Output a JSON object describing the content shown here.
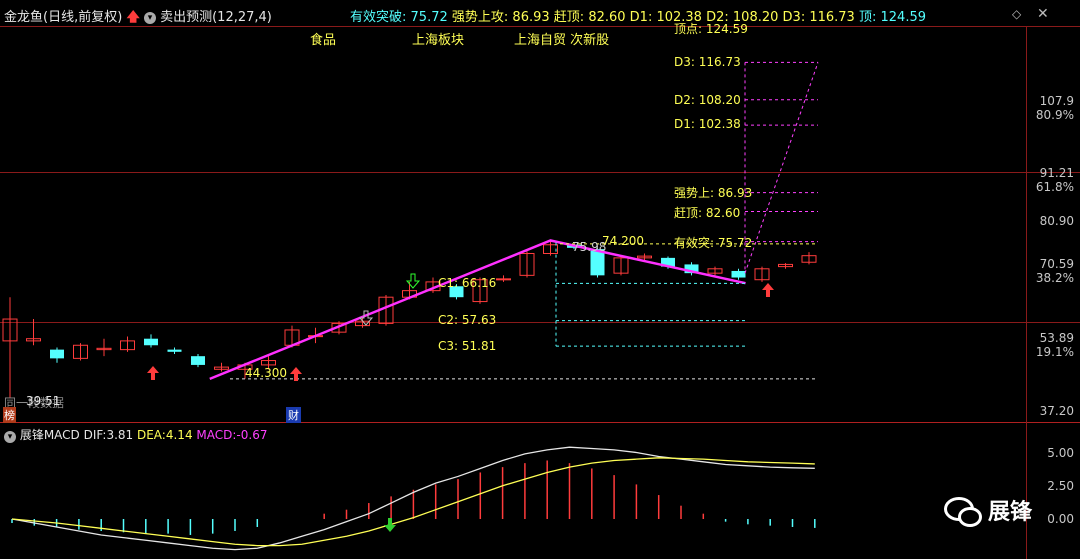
{
  "header": {
    "stock_name": "金龙鱼",
    "period": "(日线,前复权)",
    "indicator_name": "卖出预测",
    "indicator_params": "(12,27,4)",
    "targets": [
      {
        "label": "有效突破",
        "value": "75.72"
      },
      {
        "label": "强势上攻",
        "value": "86.93"
      },
      {
        "label": "赶顶",
        "value": "82.60"
      },
      {
        "label": "D1",
        "value": "102.38"
      },
      {
        "label": "D2",
        "value": "108.20"
      },
      {
        "label": "D3",
        "value": "116.73"
      },
      {
        "label": "顶",
        "value": "124.59"
      }
    ],
    "tags": [
      "食品",
      "上海板块",
      "上海自贸 次新股"
    ]
  },
  "right_levels": [
    {
      "label": "顶点: 124.59",
      "value": 124.59
    },
    {
      "label": "D3: 116.73",
      "value": 116.73
    },
    {
      "label": "D2: 108.20",
      "value": 108.2
    },
    {
      "label": "D1: 102.38",
      "value": 102.38
    },
    {
      "label": "强势上: 86.93",
      "value": 86.93
    },
    {
      "label": "赶顶: 82.60",
      "value": 82.6
    },
    {
      "label": "有效突: 75.72",
      "value": 75.72
    }
  ],
  "c_levels": [
    {
      "label": "C1: 66.16",
      "value": 66.16
    },
    {
      "label": "C2: 57.63",
      "value": 57.63
    },
    {
      "label": "C3: 51.81",
      "value": 51.81
    }
  ],
  "annotations": {
    "low_price": "44.300",
    "high_price": "75.98",
    "later_high": "74.200",
    "bottom_left_text": "同一段数据",
    "bottom_left_value": "39.51",
    "bottom_left_badge": "榜",
    "fin_badge": "财"
  },
  "price_axis": [
    {
      "v": "107.9",
      "p": "80.9%"
    },
    {
      "v": "91.21",
      "p": "61.8%"
    },
    {
      "v": "80.90",
      "p": ""
    },
    {
      "v": "70.59",
      "p": "38.2%"
    },
    {
      "v": "53.89",
      "p": "19.1%"
    },
    {
      "v": "37.20",
      "p": ""
    }
  ],
  "macd": {
    "name": "展锋MACD",
    "dif_label": "DIF:",
    "dif": "3.81",
    "dea_label": "DEA:",
    "dea": "4.14",
    "macd_label": "MACD:",
    "macd": "-0.67",
    "axis": [
      "5.00",
      "2.50",
      "0.00"
    ]
  },
  "watermark": {
    "text": "展锋"
  },
  "colors": {
    "up": "#ff3c3c",
    "down": "#54ffff",
    "trend": "#ff30ff",
    "yellow": "#ffff55",
    "cyan": "#54ffff",
    "magenta": "#ff40ff",
    "white": "#e6e6e6",
    "grid": "#8a1a1a"
  },
  "chart_data": {
    "type": "candlestick",
    "ylim": [
      37.2,
      124.59
    ],
    "candles": [
      {
        "o": 53,
        "c": 58,
        "h": 63,
        "l": 40
      },
      {
        "o": 53,
        "c": 53.5,
        "h": 58,
        "l": 52
      },
      {
        "o": 51,
        "c": 49,
        "h": 51.5,
        "l": 48
      },
      {
        "o": 49,
        "c": 52,
        "h": 52.5,
        "l": 48.5
      },
      {
        "o": 51,
        "c": 51.3,
        "h": 53.5,
        "l": 49.5
      },
      {
        "o": 51,
        "c": 53,
        "h": 54,
        "l": 50.5
      },
      {
        "o": 53.5,
        "c": 52,
        "h": 54.5,
        "l": 51.5
      },
      {
        "o": 51,
        "c": 50.5,
        "h": 51.5,
        "l": 50
      },
      {
        "o": 49.5,
        "c": 47.5,
        "h": 50,
        "l": 47
      },
      {
        "o": 46.5,
        "c": 47,
        "h": 48,
        "l": 46
      },
      {
        "o": 46.5,
        "c": 47.5,
        "h": 48,
        "l": 44.3
      },
      {
        "o": 47.5,
        "c": 48.5,
        "h": 49.5,
        "l": 46.5
      },
      {
        "o": 52,
        "c": 55.5,
        "h": 56.5,
        "l": 51.5
      },
      {
        "o": 54,
        "c": 54.2,
        "h": 56,
        "l": 52.5
      },
      {
        "o": 55,
        "c": 57,
        "h": 57.5,
        "l": 54.5
      },
      {
        "o": 56.5,
        "c": 57.5,
        "h": 58.5,
        "l": 56
      },
      {
        "o": 57,
        "c": 63,
        "h": 63.5,
        "l": 56.5
      },
      {
        "o": 63,
        "c": 64.5,
        "h": 66.5,
        "l": 62.5
      },
      {
        "o": 64.5,
        "c": 66.5,
        "h": 67.5,
        "l": 64
      },
      {
        "o": 65.5,
        "c": 63,
        "h": 66,
        "l": 62.5
      },
      {
        "o": 62,
        "c": 67,
        "h": 67.5,
        "l": 61.5
      },
      {
        "o": 67,
        "c": 67.2,
        "h": 68,
        "l": 66.5
      },
      {
        "o": 68,
        "c": 73,
        "h": 73.5,
        "l": 67.5
      },
      {
        "o": 73,
        "c": 75,
        "h": 75.98,
        "l": 72.5
      },
      {
        "o": 75,
        "c": 74.3,
        "h": 75.2,
        "l": 74
      },
      {
        "o": 74,
        "c": 68,
        "h": 74.2,
        "l": 67.5
      },
      {
        "o": 68.5,
        "c": 72,
        "h": 72.5,
        "l": 68
      },
      {
        "o": 72,
        "c": 72.4,
        "h": 73,
        "l": 71.5
      },
      {
        "o": 72,
        "c": 70,
        "h": 72.3,
        "l": 69.5
      },
      {
        "o": 70.5,
        "c": 68.5,
        "h": 71,
        "l": 68
      },
      {
        "o": 68.5,
        "c": 69.5,
        "h": 70,
        "l": 68
      },
      {
        "o": 69,
        "c": 67.5,
        "h": 69.5,
        "l": 67
      },
      {
        "o": 67,
        "c": 69.5,
        "h": 70,
        "l": 66.5
      },
      {
        "o": 70,
        "c": 70.5,
        "h": 70.8,
        "l": 69.5
      },
      {
        "o": 71,
        "c": 72.5,
        "h": 73.3,
        "l": 70.5
      }
    ],
    "macd_hist": [
      -0.3,
      -0.5,
      -0.6,
      -0.8,
      -0.9,
      -1.0,
      -1.1,
      -1.1,
      -1.2,
      -1.1,
      -0.9,
      -0.6,
      0,
      0,
      0.4,
      0.7,
      1.2,
      1.7,
      2.2,
      2.6,
      3.0,
      3.5,
      3.9,
      4.2,
      4.4,
      4.2,
      3.8,
      3.3,
      2.6,
      1.8,
      1.0,
      0.4,
      -0.2,
      -0.4,
      -0.5,
      -0.6,
      -0.67
    ],
    "dif": [
      0,
      -0.3,
      -0.6,
      -0.9,
      -1.2,
      -1.4,
      -1.6,
      -1.8,
      -2.0,
      -2.2,
      -2.3,
      -2.2,
      -1.8,
      -1.3,
      -0.8,
      -0.2,
      0.4,
      1.2,
      2.0,
      2.7,
      3.2,
      3.8,
      4.4,
      4.9,
      5.2,
      5.4,
      5.3,
      5.2,
      5.0,
      4.7,
      4.5,
      4.3,
      4.1,
      4.0,
      3.9,
      3.85,
      3.81
    ],
    "dea": [
      0,
      -0.15,
      -0.3,
      -0.5,
      -0.7,
      -0.9,
      -1.1,
      -1.3,
      -1.5,
      -1.7,
      -1.9,
      -2.0,
      -2.0,
      -1.9,
      -1.6,
      -1.3,
      -0.9,
      -0.4,
      0.1,
      0.7,
      1.3,
      1.9,
      2.5,
      3.0,
      3.5,
      3.9,
      4.2,
      4.4,
      4.5,
      4.6,
      4.55,
      4.5,
      4.4,
      4.3,
      4.25,
      4.2,
      4.14
    ]
  }
}
